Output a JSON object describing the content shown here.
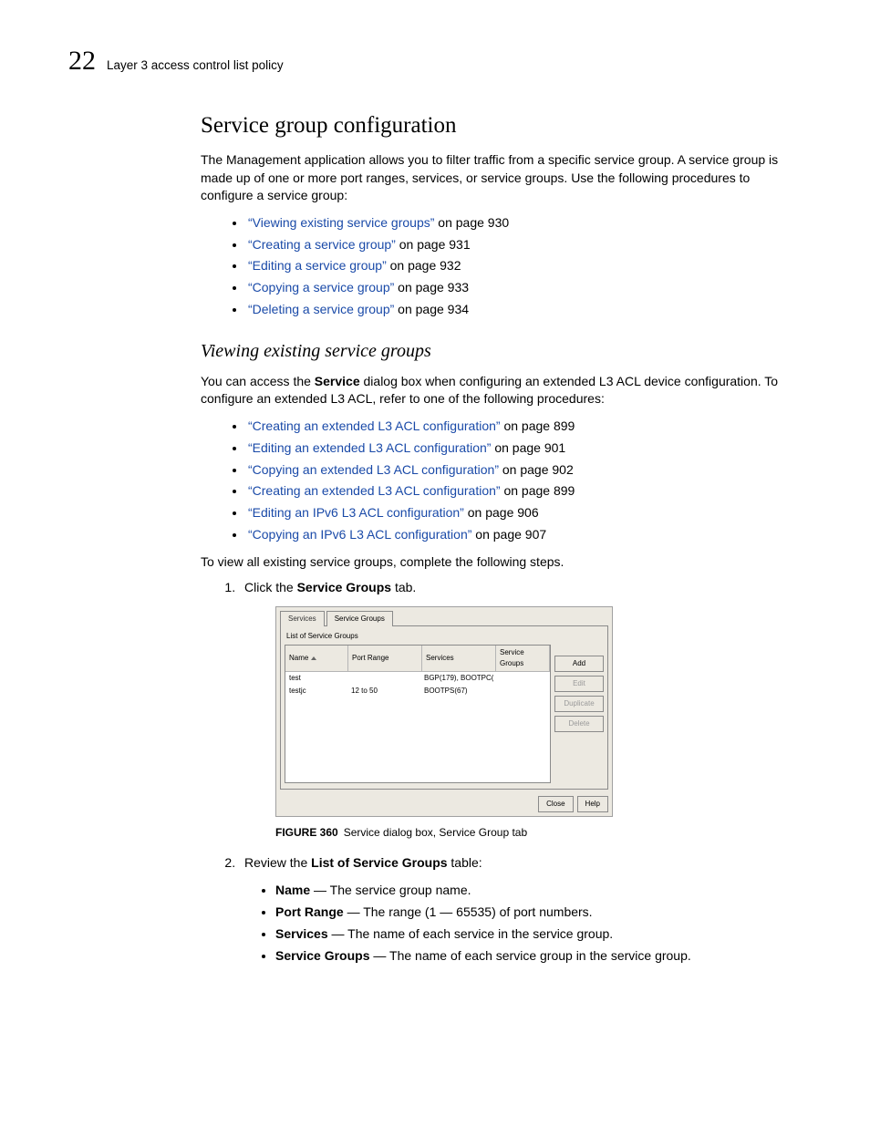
{
  "header": {
    "page_number": "22",
    "running_title": "Layer 3 access control list policy"
  },
  "section": {
    "title": "Service group configuration",
    "intro": "The Management application allows you to filter traffic from a specific service group. A service group is made up of one or more port ranges, services, or service groups. Use the following procedures to configure a service group:",
    "links": [
      {
        "text": "“Viewing existing service groups”",
        "suffix": " on page 930"
      },
      {
        "text": "“Creating a service group”",
        "suffix": " on page 931"
      },
      {
        "text": "“Editing a service group”",
        "suffix": " on page 932"
      },
      {
        "text": "“Copying a service group”",
        "suffix": " on page 933"
      },
      {
        "text": "“Deleting a service group”",
        "suffix": " on page 934"
      }
    ]
  },
  "subsection": {
    "title": "Viewing existing service groups",
    "para_before_bold": "You can access the ",
    "para_bold": "Service",
    "para_after_bold": " dialog box when configuring an extended L3 ACL device configuration. To configure an extended L3 ACL, refer to one of the following procedures:",
    "links": [
      {
        "text": "“Creating an extended L3 ACL configuration”",
        "suffix": " on page 899"
      },
      {
        "text": "“Editing an extended L3 ACL configuration”",
        "suffix": " on page 901"
      },
      {
        "text": "“Copying an extended L3 ACL configuration”",
        "suffix": " on page 902"
      },
      {
        "text": "“Creating an extended L3 ACL configuration”",
        "suffix": " on page 899"
      },
      {
        "text": "“Editing an IPv6 L3 ACL configuration”",
        "suffix": " on page 906"
      },
      {
        "text": "“Copying an IPv6 L3 ACL configuration”",
        "suffix": " on page 907"
      }
    ],
    "lead_out": "To view all existing service groups, complete the following steps."
  },
  "steps": {
    "s1_before": "Click the ",
    "s1_bold": "Service Groups",
    "s1_after": " tab.",
    "s2_before": "Review the ",
    "s2_bold": "List of Service Groups",
    "s2_after": " table:"
  },
  "dialog": {
    "tabs": {
      "services": "Services",
      "service_groups": "Service Groups"
    },
    "list_label": "List of Service Groups",
    "columns": {
      "name": "Name",
      "port": "Port Range",
      "services": "Services",
      "groups": "Service Groups"
    },
    "rows": [
      {
        "name": "test",
        "port": "",
        "services": "BGP(179), BOOTPC(...",
        "groups": ""
      },
      {
        "name": "testjc",
        "port": "12 to 50",
        "services": "BOOTPS(67)",
        "groups": ""
      }
    ],
    "buttons": {
      "add": "Add",
      "edit": "Edit",
      "duplicate": "Duplicate",
      "delete": "Delete",
      "close": "Close",
      "help": "Help"
    }
  },
  "figure": {
    "label": "FIGURE 360",
    "caption": "Service dialog box, Service Group tab"
  },
  "fields": {
    "name": {
      "label": "Name",
      "desc": " — The service group name."
    },
    "port": {
      "label": "Port Range",
      "desc": " — The range (1 — 65535) of port numbers."
    },
    "services": {
      "label": "Services",
      "desc": " — The name of each service in the service group."
    },
    "groups": {
      "label": "Service Groups",
      "desc": " — The name of each service group in the service group."
    }
  }
}
